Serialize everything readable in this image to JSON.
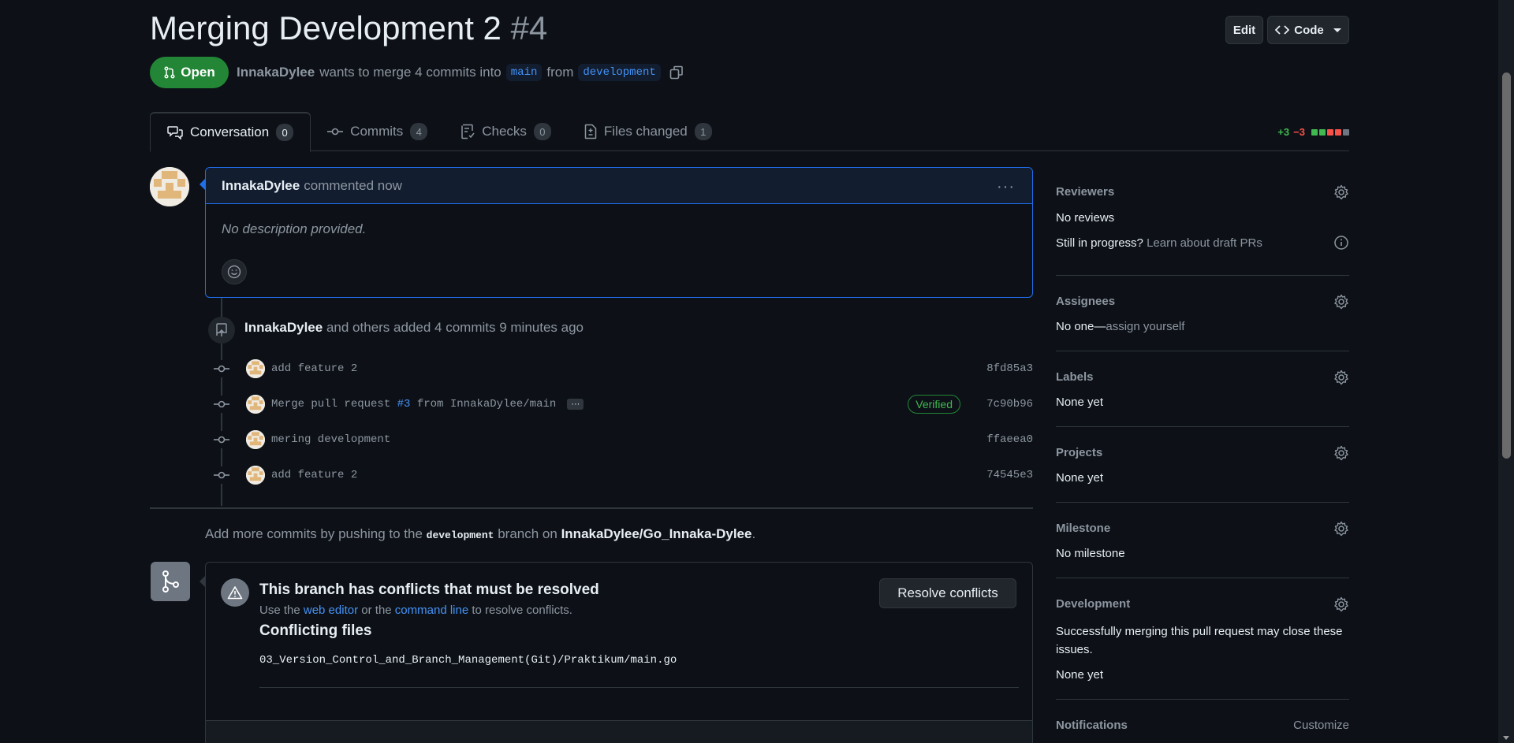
{
  "pr": {
    "title": "Merging Development 2",
    "number": "#4",
    "edit_label": "Edit",
    "code_label": "Code",
    "state_label": "Open",
    "author": "InnakaDylee",
    "merge_text": "wants to merge 4 commits into",
    "base_branch": "main",
    "from_text": "from",
    "head_branch": "development"
  },
  "tabs": [
    {
      "label": "Conversation",
      "count": "0"
    },
    {
      "label": "Commits",
      "count": "4"
    },
    {
      "label": "Checks",
      "count": "0"
    },
    {
      "label": "Files changed",
      "count": "1"
    }
  ],
  "diffstat": {
    "additions": "+3",
    "deletions": "−3"
  },
  "comment": {
    "author": "InnakaDylee",
    "when": "commented now",
    "body": "No description provided."
  },
  "commits_event": {
    "author": "InnakaDylee",
    "text": "and others added 4 commits 9 minutes ago"
  },
  "commits": [
    {
      "message": "add feature 2",
      "sha": "8fd85a3",
      "verified": ""
    },
    {
      "message_pre": "Merge pull request ",
      "pr_ref": "#3",
      "message_post": " from InnakaDylee/main",
      "sha": "7c90b96",
      "verified": "Verified"
    },
    {
      "message": "mering development",
      "sha": "ffaeea0",
      "verified": ""
    },
    {
      "message": "add feature 2",
      "sha": "74545e3",
      "verified": ""
    }
  ],
  "push_hint": {
    "prefix": "Add more commits by pushing to the",
    "branch": "development",
    "middle": "branch on",
    "repo": "InnakaDylee/Go_Innaka-Dylee",
    "suffix": "."
  },
  "merge": {
    "title": "This branch has conflicts that must be resolved",
    "sub_prefix": "Use the",
    "web_editor": "web editor",
    "sub_mid": "or the",
    "command_line": "command line",
    "sub_suffix": "to resolve conflicts.",
    "resolve_label": "Resolve conflicts",
    "conflicting_title": "Conflicting files",
    "file": "03_Version_Control_and_Branch_Management(Git)/Praktikum/main.go"
  },
  "sidebar": {
    "reviewers": {
      "title": "Reviewers",
      "value": "No reviews",
      "draft_q": "Still in progress?",
      "draft_link": "Learn about draft PRs"
    },
    "assignees": {
      "title": "Assignees",
      "value": "No one—",
      "assign_link": "assign yourself"
    },
    "labels": {
      "title": "Labels",
      "value": "None yet"
    },
    "projects": {
      "title": "Projects",
      "value": "None yet"
    },
    "milestone": {
      "title": "Milestone",
      "value": "No milestone"
    },
    "development": {
      "title": "Development",
      "desc": "Successfully merging this pull request may close these issues.",
      "value": "None yet"
    },
    "notifications": {
      "title": "Notifications",
      "customize": "Customize"
    }
  },
  "colors": {
    "open_green": "#238636",
    "link_blue": "#4493f8",
    "bg": "#0d1117",
    "diff_add": "#3fb950",
    "diff_del": "#f85149"
  }
}
